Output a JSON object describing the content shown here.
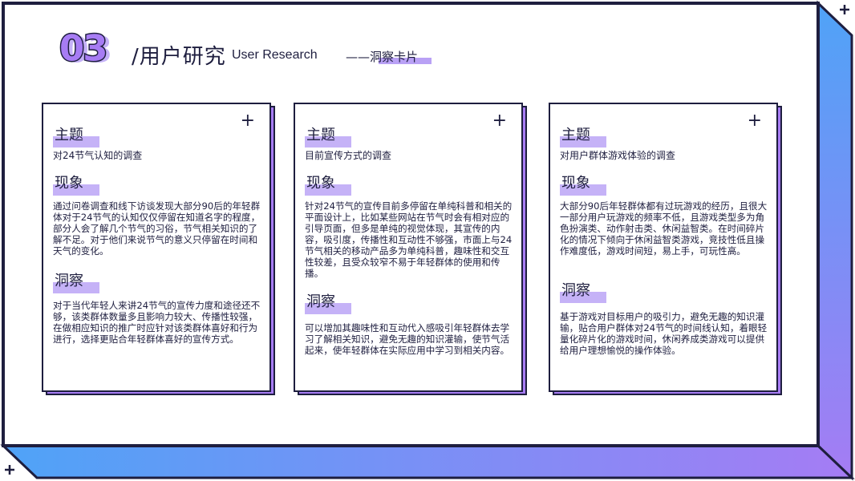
{
  "header": {
    "number": "03",
    "title": "/用户研究",
    "title_en": "User Research",
    "subtitle": "——洞察卡片"
  },
  "cards": [
    {
      "topic_label": "主题",
      "topic": "对24节气认知的调查",
      "phenomenon_label": "现象",
      "phenomenon": "通过问卷调查和线下访谈发现大部分90后的年轻群体对于24节气的认知仅仅停留在知道名字的程度，部分人会了解几个节气的习俗，节气相关知识的了解不足。对于他们来说节气的意义只停留在时间和天气的变化。",
      "insight_label": "洞察",
      "insight": "对于当代年轻人来讲24节气的宣传力度和途径还不够，该类群体数量多且影响力较大、传播性较强，在做相应知识的推广时应针对该类群体喜好和行为进行，选择更贴合年轻群体喜好的宣传方式。"
    },
    {
      "topic_label": "主题",
      "topic": "目前宣传方式的调查",
      "phenomenon_label": "现象",
      "phenomenon": "针对24节气的宣传目前多停留在单纯科普和相关的平面设计上，比如某些网站在节气时会有相对应的引导页面，但多是单纯的视觉体现，其宣传的内容，吸引度，传播性和互动性不够强，市面上与24节气相关的移动产品多为单纯科普，趣味性和交互性较差，且受众较窄不易于年轻群体的使用和传播。",
      "insight_label": "洞察",
      "insight": "可以增加其趣味性和互动代入感吸引年轻群体去学习了解相关知识，避免无趣的知识灌输，使节气活起来，使年轻群体在实际应用中学习到相关内容。"
    },
    {
      "topic_label": "主题",
      "topic": "对用户群体游戏体验的调查",
      "phenomenon_label": "现象",
      "phenomenon": "大部分90后年轻群体都有过玩游戏的经历，且很大一部分用户玩游戏的频率不低，且游戏类型多为角色扮演类、动作射击类、休闲益智类。在时间碎片化的情况下倾向于休闲益智类游戏，竞技性低且操作难度低，游戏时间短，易上手，可玩性高。",
      "insight_label": "洞察",
      "insight": "基于游戏对目标用户的吸引力，避免无趣的知识灌输，贴合用户群体对24节气的时间线认知，着眼轻量化碎片化的游戏时间，休闲养成类游戏可以提供给用户理想愉悦的操作体验。"
    }
  ],
  "colors": {
    "ink": "#1e1e3f",
    "purple": "#a77cf4",
    "highlight": "#c5b2f7",
    "blue": "#4fa3f7"
  },
  "icons": [
    "plus-icon"
  ]
}
